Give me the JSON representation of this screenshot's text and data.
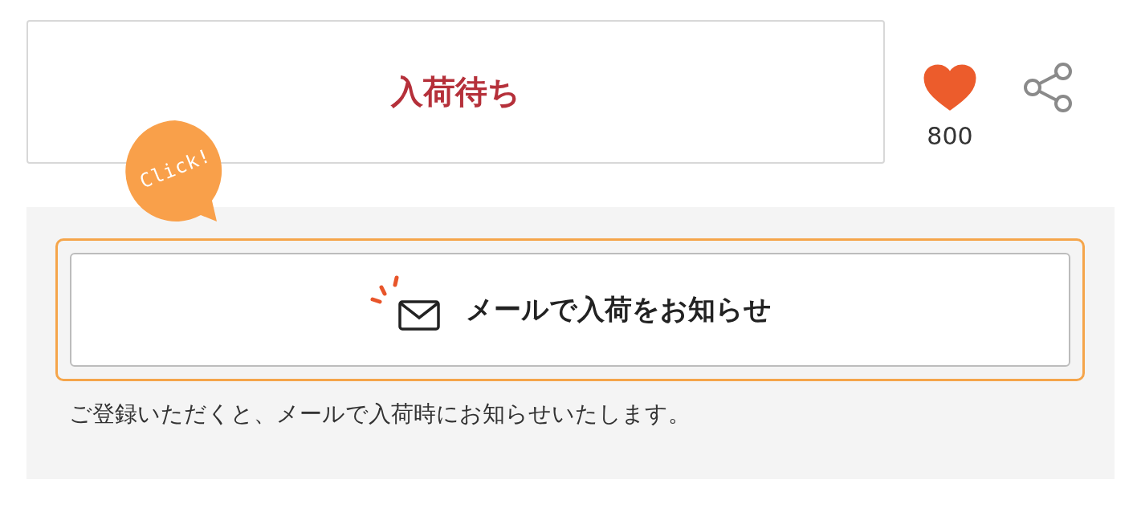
{
  "stock_status": {
    "label": "入荷待ち"
  },
  "favorite": {
    "liked": true,
    "count": "800"
  },
  "callout": {
    "label": "Click!"
  },
  "notify_button": {
    "label": "メールで入荷をお知らせ",
    "highlighted": true
  },
  "note": "ご登録いただくと、メールで入荷時にお知らせいたします。"
}
